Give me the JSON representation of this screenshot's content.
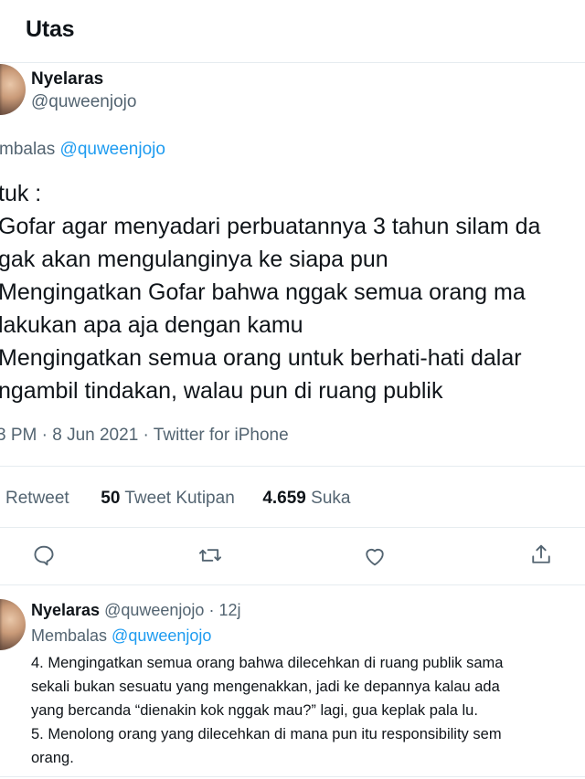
{
  "header": {
    "title": "Utas"
  },
  "main_tweet": {
    "author_name": "Nyelaras",
    "author_handle": "@quweenjojo",
    "reply_prefix": "mbalas",
    "reply_handle": "@quweenjojo",
    "lines": [
      "tuk :",
      "Gofar agar menyadari perbuatannya 3 tahun silam da",
      "gak akan mengulanginya ke siapa pun",
      "Mengingatkan Gofar bahwa nggak semua orang ma",
      "lakukan apa aja dengan kamu",
      "Mengingatkan semua orang untuk berhati-hati dalar",
      "ngambil tindakan, walau pun di ruang publik"
    ],
    "meta": "3 PM · 8 Jun 2021 · Twitter for iPhone",
    "stats": {
      "retweet_label": "Retweet",
      "quote_count": "50",
      "quote_label": "Tweet Kutipan",
      "like_count": "4.659",
      "like_label": "Suka"
    }
  },
  "actions": [
    {
      "name": "reply-icon"
    },
    {
      "name": "retweet-icon"
    },
    {
      "name": "like-icon"
    },
    {
      "name": "share-icon"
    }
  ],
  "reply_tweet": {
    "author_name": "Nyelaras",
    "author_handle": "@quweenjojo",
    "time": "· 12j",
    "reply_prefix": "Membalas",
    "reply_handle": "@quweenjojo",
    "lines": [
      "4. Mengingatkan semua orang bahwa dilecehkan di ruang publik sama",
      "sekali bukan sesuatu yang mengenakkan, jadi ke depannya kalau ada",
      "yang bercanda “dienakin kok nggak mau?” lagi, gua keplak pala lu.",
      "5. Menolong orang yang dilecehkan di mana pun itu responsibility sem",
      "orang."
    ]
  },
  "colors": {
    "link": "#1d9bf0",
    "secondary": "#536471",
    "divider": "#e6ecf0"
  }
}
